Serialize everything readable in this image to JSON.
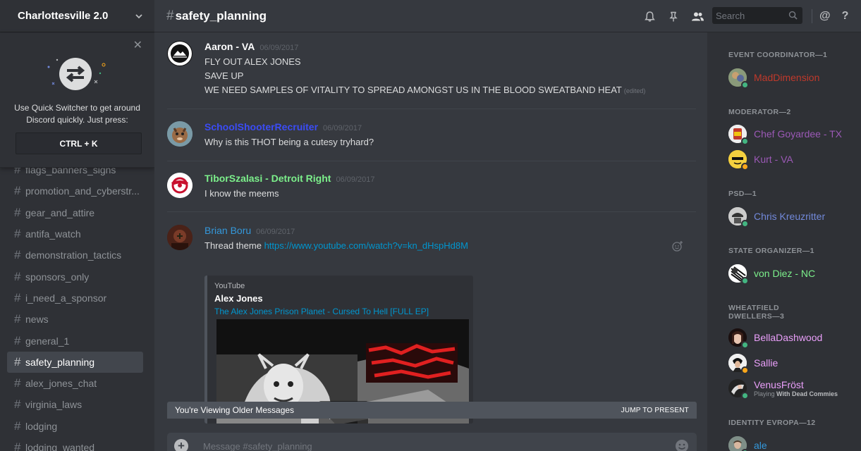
{
  "server": {
    "name": "Charlottesville 2.0"
  },
  "quick_switcher": {
    "text": "Use Quick Switcher to get around Discord quickly. Just press:",
    "shortcut": "CTRL + K"
  },
  "channels": [
    {
      "name": "flags_banners_signs"
    },
    {
      "name": "promotion_and_cyberstr..."
    },
    {
      "name": "gear_and_attire"
    },
    {
      "name": "antifa_watch"
    },
    {
      "name": "demonstration_tactics"
    },
    {
      "name": "sponsors_only"
    },
    {
      "name": "i_need_a_sponsor"
    },
    {
      "name": "news"
    },
    {
      "name": "general_1"
    },
    {
      "name": "safety_planning",
      "active": true
    },
    {
      "name": "alex_jones_chat"
    },
    {
      "name": "virginia_laws"
    },
    {
      "name": "lodging"
    },
    {
      "name": "lodging_wanted"
    }
  ],
  "header": {
    "hash": "#",
    "channel": "safety_planning",
    "search_placeholder": "Search",
    "at_icon": "@",
    "help_icon": "?"
  },
  "messages": [
    {
      "user": "Aaron - VA",
      "color": "#ffffff",
      "time": "06/09/2017",
      "lines": [
        "FLY OUT ALEX JONES",
        "SAVE UP",
        "WE NEED SAMPLES OF VITALITY TO SPREAD AMONGST US IN THE BLOOD SWEATBAND HEAT"
      ],
      "edited": "(edited)"
    },
    {
      "user": "SchoolShooterRecruiter",
      "color": "#3b4cf5",
      "time": "06/09/2017",
      "lines": [
        "Why is this THOT being a cutesy tryhard?"
      ]
    },
    {
      "user": "TiborSzalasi - Detroit Right",
      "color": "#7cf08b",
      "time": "06/09/2017",
      "lines": [
        "I know the meems"
      ]
    },
    {
      "user": "Brian Boru",
      "color": "#3498db",
      "time": "06/09/2017",
      "text": "Thread theme",
      "link": "https://www.youtube.com/watch?v=kn_dHspHd8M",
      "embed": {
        "provider": "YouTube",
        "author": "Alex Jones",
        "title": "The Alex Jones Prison Planet - Cursed To Hell [FULL EP]"
      }
    }
  ],
  "older_bar": {
    "text": "You're Viewing Older Messages",
    "jump": "JUMP TO PRESENT"
  },
  "input": {
    "placeholder": "Message #safety_planning"
  },
  "member_roles": [
    {
      "title": "EVENT COORDINATOR—1",
      "members": [
        {
          "name": "MadDimension",
          "color": "#c0392b",
          "status": "online"
        }
      ]
    },
    {
      "title": "MODERATOR—2",
      "members": [
        {
          "name": "Chef Goyardee - TX",
          "color": "#9b59b6",
          "status": "online"
        },
        {
          "name": "Kurt - VA",
          "color": "#9b59b6",
          "status": "idle"
        }
      ]
    },
    {
      "title": "PSD—1",
      "members": [
        {
          "name": "Chris Kreuzritter",
          "color": "#7289da",
          "status": "online"
        }
      ]
    },
    {
      "title": "STATE ORGANIZER—1",
      "members": [
        {
          "name": "von Diez - NC",
          "color": "#7cf08b",
          "status": "online"
        }
      ]
    },
    {
      "title": "WHEATFIELD DWELLERS—3",
      "members": [
        {
          "name": "BellaDashwood",
          "color": "#ea9ffa",
          "status": "online"
        },
        {
          "name": "Sallie",
          "color": "#ea9ffa",
          "status": "idle"
        },
        {
          "name": "VenusFröst",
          "color": "#ea9ffa",
          "status": "online",
          "activity_prefix": "Playing",
          "activity": "With Dead Commies"
        }
      ]
    },
    {
      "title": "IDENTITY EVROPA—12",
      "members": [
        {
          "name": "ale",
          "color": "#3498db",
          "status": "online"
        }
      ]
    }
  ],
  "colors": {
    "online": "#43b581",
    "idle": "#faa61a",
    "link": "#0096cf"
  }
}
